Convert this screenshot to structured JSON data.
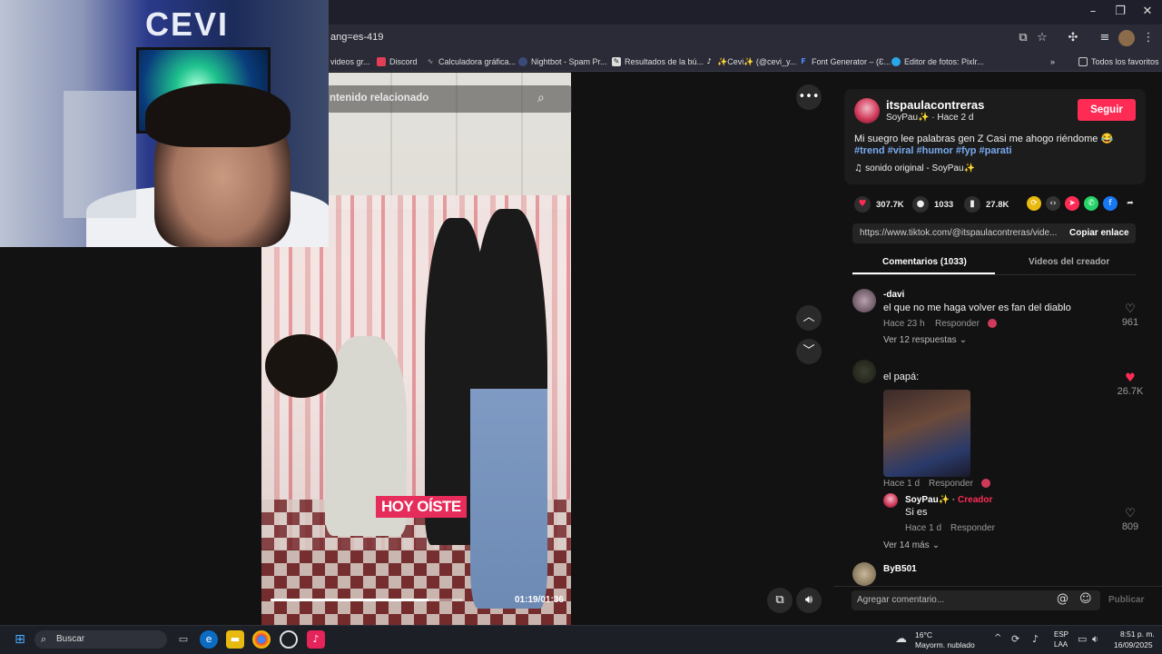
{
  "browser": {
    "url": "ang=es-419",
    "bookmarks": [
      {
        "label": "videos gr...",
        "icon": "globe-icon"
      },
      {
        "label": "Discord",
        "icon": "discord-icon"
      },
      {
        "label": "Calculadora gráfica...",
        "icon": "desmos-icon"
      },
      {
        "label": "Nightbot - Spam Pr...",
        "icon": "nightbot-icon"
      },
      {
        "label": "Resultados de la bú...",
        "icon": "search-results-icon"
      },
      {
        "label": "✨Cevi✨ (@cevi_y...",
        "icon": "tiktok-icon"
      },
      {
        "label": "Font Generator – (Ɛ...",
        "icon": "font-icon"
      },
      {
        "label": "Editor de fotos: Pixlr...",
        "icon": "pixlr-icon"
      }
    ],
    "all_favorites": "Todos los favoritos"
  },
  "video": {
    "search_placeholder": "ntenido relacionado",
    "caption": "HOY OÍSTE",
    "time": "01:19/01:36",
    "progress": 0.82
  },
  "webcam": {
    "logo_text": "CEVI"
  },
  "creator": {
    "username": "itspaulacontreras",
    "subline": "SoyPau✨ · Hace 2 d",
    "follow_label": "Seguir",
    "description": "Mi suegro lee palabras gen Z Casi me ahogo riéndome 😂",
    "hashtags": "#trend #viral #humor #fyp #parati",
    "sound": "sonido original - SoyPau✨"
  },
  "stats": {
    "likes": "307.7K",
    "comments": "1033",
    "saves": "27.8K"
  },
  "share": {
    "link": "https://www.tiktok.com/@itspaulacontreras/vide...",
    "copy_label": "Copiar enlace"
  },
  "tabs": {
    "comments": "Comentarios (1033)",
    "creator_videos": "Videos del creador"
  },
  "comments": [
    {
      "user": "-davi",
      "text": "el que no me haga volver es fan del diablo",
      "time": "Hace 23 h",
      "reply": "Responder",
      "likes": "961",
      "more": "Ver 12 respuestas"
    },
    {
      "user": "",
      "text": "el papá:",
      "time": "Hace 1 d",
      "reply": "Responder",
      "likes": "26.7K",
      "more": "Ver 14 más"
    },
    {
      "user": "ByB501",
      "text": "",
      "time": "",
      "reply": "",
      "likes": "",
      "more": ""
    }
  ],
  "creator_reply": {
    "user": "SoyPau✨",
    "tag": "Creador",
    "text": "Si es",
    "time": "Hace 1 d",
    "reply": "Responder",
    "likes": "809"
  },
  "comment_box": {
    "placeholder": "Agregar comentario...",
    "publish": "Publicar"
  },
  "taskbar": {
    "search": "Buscar",
    "temp": "16°C",
    "weather": "Mayorm. nublado",
    "lang1": "ESP",
    "lang2": "LAA",
    "time": "8:51 p. m.",
    "date": "16/09/2025"
  },
  "colors": {
    "accent": "#fe2c55",
    "hashtag": "#78aaf0",
    "caption_bg": "#e62c5a"
  }
}
